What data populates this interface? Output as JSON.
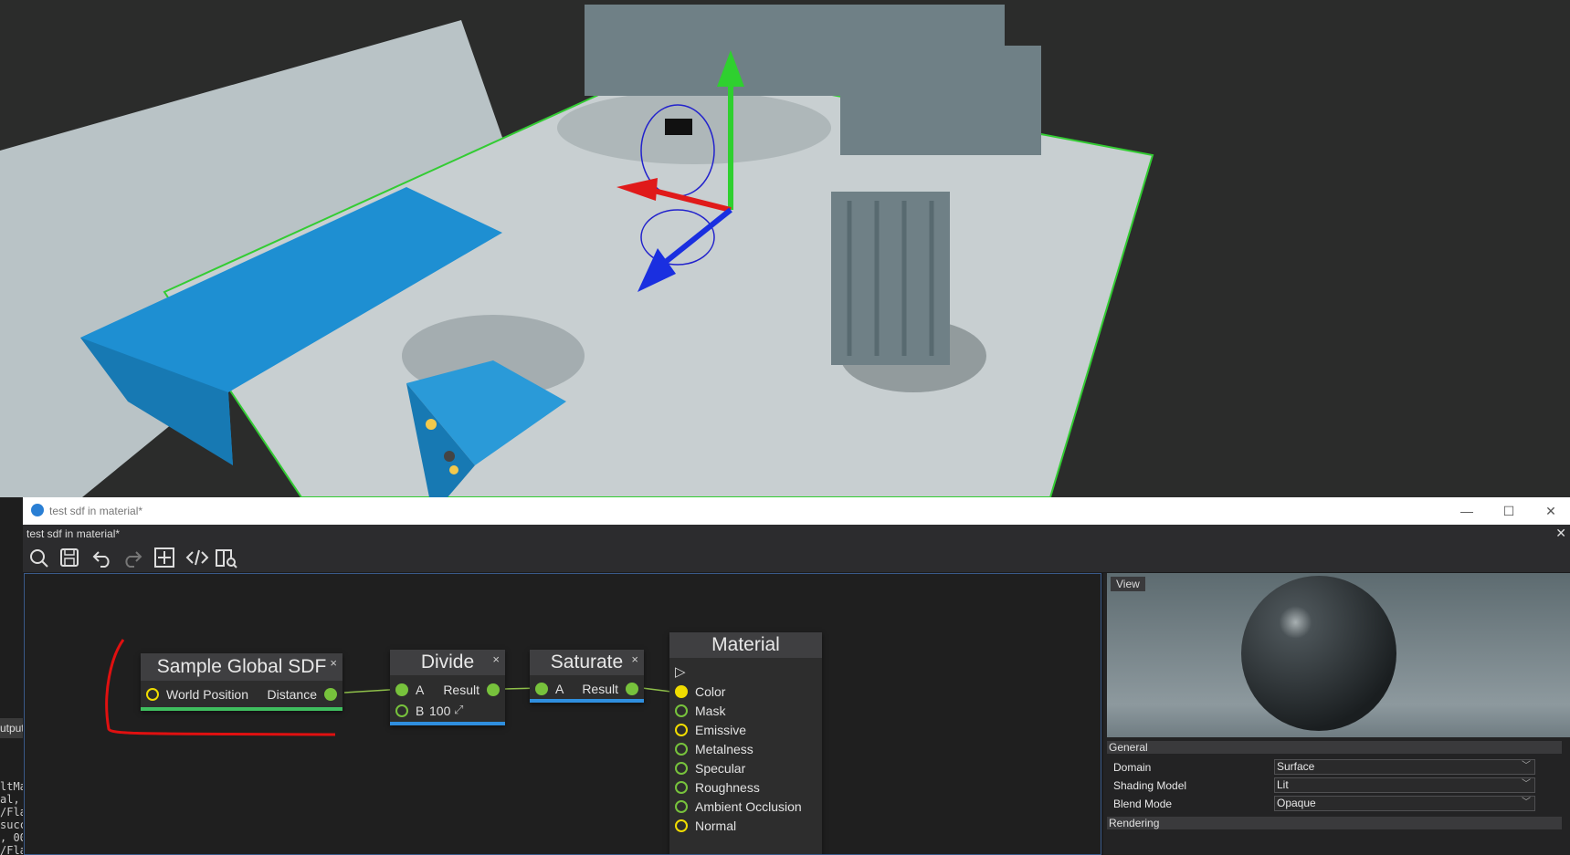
{
  "window": {
    "title": "test sdf in material*",
    "minimize": "—",
    "maximize": "☐",
    "close": "✕"
  },
  "document": {
    "tab_title": "test sdf in material*",
    "close": "✕"
  },
  "toolbar": {
    "items": [
      "search",
      "save",
      "undo",
      "redo",
      "show-whole-graph",
      "source-code",
      "docs"
    ]
  },
  "left_strip": {
    "tab_label": "utput",
    "log_lines": [
      "ltMa",
      "al,",
      "/Fla",
      "succ",
      ", 00",
      "/Fla"
    ]
  },
  "graph": {
    "nodes": {
      "sample_sdf": {
        "title": "Sample Global SDF",
        "close": "×",
        "input": "World Position",
        "output": "Distance",
        "bar_color": "#3fbf5f"
      },
      "divide": {
        "title": "Divide",
        "close": "×",
        "in_a": "A",
        "in_b": "B",
        "b_value": "100",
        "b_icon": "⤢",
        "output": "Result",
        "bar_color": "#2f8fdf"
      },
      "saturate": {
        "title": "Saturate",
        "close": "×",
        "in_a": "A",
        "output": "Result",
        "bar_color": "#2f8fdf"
      },
      "material": {
        "title": "Material",
        "run_icon": "▷",
        "inputs": [
          "Color",
          "Mask",
          "Emissive",
          "Metalness",
          "Specular",
          "Roughness",
          "Ambient Occlusion",
          "Normal"
        ]
      }
    }
  },
  "preview": {
    "view_button": "View"
  },
  "properties": {
    "general_header": "General",
    "rows": [
      {
        "label": "Domain",
        "value": "Surface"
      },
      {
        "label": "Shading Model",
        "value": "Lit"
      },
      {
        "label": "Blend Mode",
        "value": "Opaque"
      }
    ],
    "rendering_header": "Rendering",
    "dropdown_chevron": "﹀"
  },
  "colors": {
    "accent_green": "#77c23c",
    "pin_yellow": "#f0dc00",
    "annotation_red": "#e01010",
    "scene_floor": "#c9cfd0",
    "scene_blue": "#1e8fd2"
  }
}
